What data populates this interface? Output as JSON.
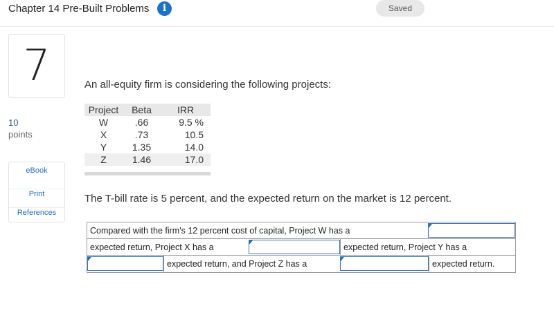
{
  "header": {
    "title": "Chapter 14 Pre-Built Problems",
    "info_icon": "info-icon",
    "saved_label": "Saved"
  },
  "sidebar": {
    "question_number": "7",
    "points_value": "10",
    "points_label": "points",
    "links": [
      "eBook",
      "Print",
      "References"
    ]
  },
  "question": {
    "intro": "An all-equity firm is considering the following projects:",
    "table": {
      "headers": [
        "Project",
        "Beta",
        "IRR"
      ],
      "rows": [
        [
          "W",
          ".66",
          "9.5 %"
        ],
        [
          "X",
          ".73",
          "10.5"
        ],
        [
          "Y",
          "1.35",
          "14.0"
        ],
        [
          "Z",
          "1.46",
          "17.0"
        ]
      ]
    },
    "market_text": "The T-bill rate is 5 percent, and the expected return on the market is 12 percent."
  },
  "answer": {
    "row1_text": "Compared with the firm's 12 percent cost of capital, Project W has a",
    "row2_text_a": "expected return, Project X has a",
    "row2_text_b": "expected return, Project Y has a",
    "row3_text_a": "expected return, and Project Z has a",
    "row3_text_b": "expected return.",
    "dropdown_values": [
      "",
      "",
      "",
      ""
    ]
  },
  "colors": {
    "accent": "#1a73c8",
    "link": "#2a6db3",
    "input_border": "#3b74b8"
  }
}
